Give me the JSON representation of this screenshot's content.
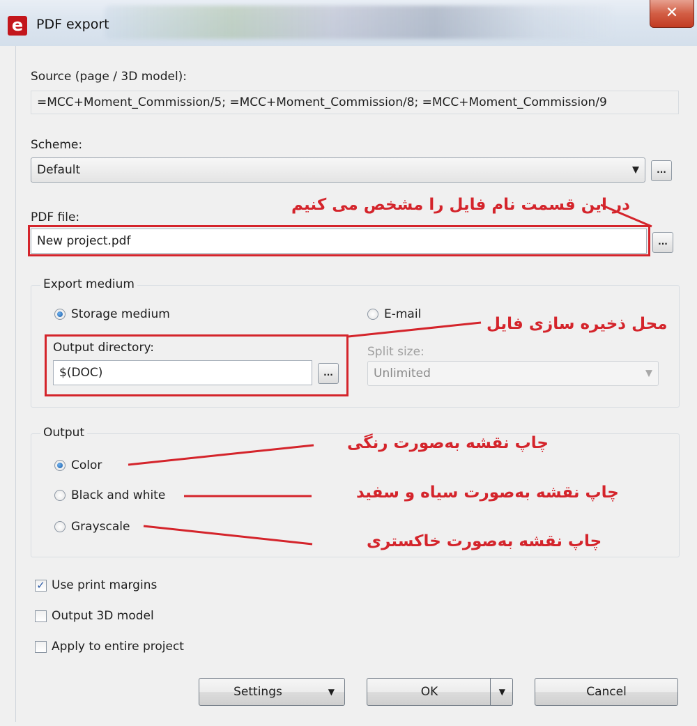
{
  "window": {
    "title": "PDF export",
    "close_glyph": "✕"
  },
  "source": {
    "label": "Source (page / 3D model):",
    "value": "=MCC+Moment_Commission/5; =MCC+Moment_Commission/8; =MCC+Moment_Commission/9"
  },
  "scheme": {
    "label": "Scheme:",
    "value": "Default",
    "browse_label": "..."
  },
  "pdf_file": {
    "label": "PDF file:",
    "value": "New project.pdf",
    "browse_label": "..."
  },
  "export_medium": {
    "group_title": "Export medium",
    "storage_label": "Storage medium",
    "storage_selected": true,
    "email_label": "E-mail",
    "email_selected": false,
    "output_dir_label": "Output directory:",
    "output_dir_value": "$(DOC)",
    "browse_label": "...",
    "split_label": "Split size:",
    "split_value": "Unlimited"
  },
  "output": {
    "group_title": "Output",
    "options": [
      "Color",
      "Black and white",
      "Grayscale"
    ],
    "selected": "Color"
  },
  "checkboxes": {
    "use_print_margins": {
      "label": "Use print margins",
      "checked": true
    },
    "output_3d_model": {
      "label": "Output 3D model",
      "checked": false
    },
    "apply_entire_project": {
      "label": "Apply to entire project",
      "checked": false
    },
    "check_glyph": "✓"
  },
  "buttons": {
    "settings": "Settings",
    "ok": "OK",
    "cancel": "Cancel",
    "dropdown_glyph": "▼"
  },
  "annotations": {
    "pdf_file_note": "در این قسمت نام فایل را مشخص می کنیم",
    "directory_note": "محل ذخیره سازی فایل",
    "color_note": "چاپ نقشه به‌صورت رنگی",
    "bw_note": "چاپ نقشه به‌صورت سیاه و سفید",
    "gray_note": "چاپ نقشه به‌صورت خاکستری",
    "color": "#d4242b"
  }
}
